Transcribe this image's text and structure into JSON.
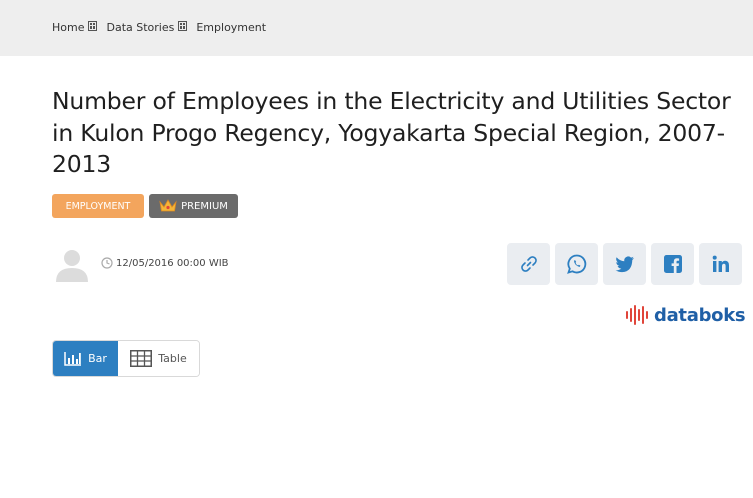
{
  "breadcrumb": {
    "items": [
      "Home",
      "Data Stories",
      "Employment"
    ]
  },
  "article": {
    "title": "Number of Employees in the Electricity and Utilities Sector in Kulon Progo Regency, Yogyakarta Special Region, 2007-2013",
    "category_badge": "EMPLOYMENT",
    "premium_badge": "PREMIUM",
    "timestamp": "12/05/2016 00:00 WIB"
  },
  "share": {
    "icons": [
      "link-icon",
      "whatsapp-icon",
      "twitter-icon",
      "facebook-icon",
      "linkedin-icon"
    ]
  },
  "brand": {
    "logo_text": "databoks"
  },
  "view_tabs": {
    "bar_label": "Bar",
    "table_label": "Table",
    "active": "Bar"
  },
  "colors": {
    "topbar": "#eeeeee",
    "employment_badge": "#f3a55d",
    "premium_badge": "#6b6b6b",
    "share_button_bg": "#eaedf1",
    "share_icon": "#2d7fc1",
    "active_tab": "#2d7fc1",
    "logo_blue": "#1f5fa6",
    "logo_red": "#e0453a"
  }
}
